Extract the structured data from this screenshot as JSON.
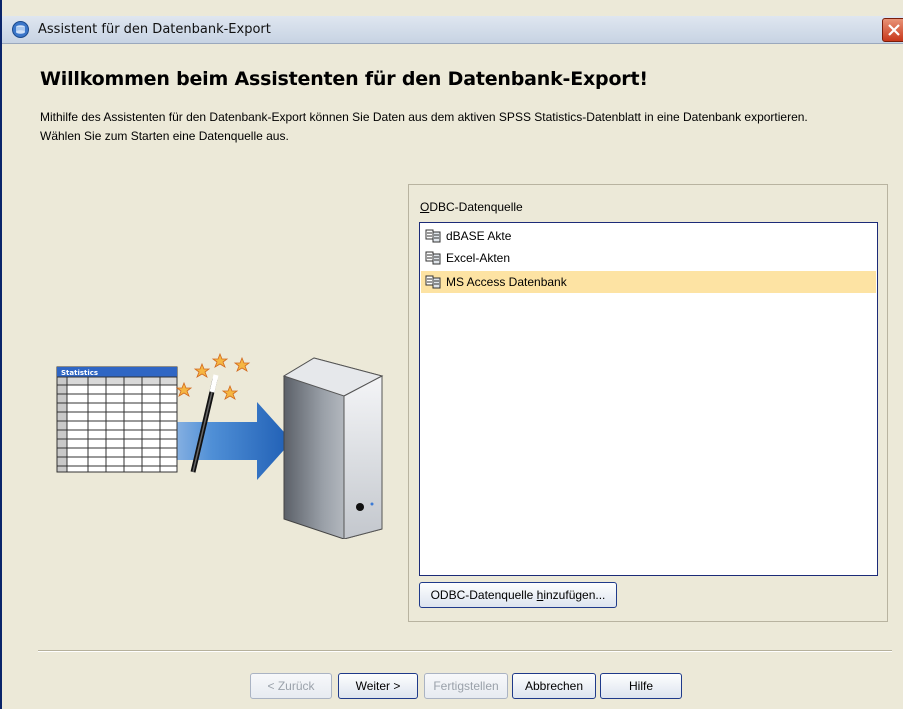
{
  "window": {
    "title": "Assistent für den Datenbank-Export"
  },
  "main": {
    "heading": "Willkommen beim Assistenten für den Datenbank-Export!",
    "description_line1": "Mithilfe des Assistenten für den Datenbank-Export können Sie Daten aus dem aktiven SPSS Statistics-Datenblatt in eine Datenbank exportieren.",
    "description_line2": "Wählen Sie zum Starten eine Datenquelle aus.",
    "illustration_label": "Statistics"
  },
  "odbc": {
    "label_prefix": "O",
    "label_rest": "DBC-Datenquelle",
    "items": [
      {
        "label": "dBASE Akte",
        "icon": "database-icon",
        "selected": false
      },
      {
        "label": "Excel-Akten",
        "icon": "database-icon",
        "selected": false
      },
      {
        "label": "MS Access Datenbank",
        "icon": "database-icon",
        "selected": true
      }
    ],
    "add_button_prefix": "ODBC-Datenquelle ",
    "add_button_mnemonic": "h",
    "add_button_suffix": "inzufügen..."
  },
  "footer": {
    "back": "< Zurück",
    "next": "Weiter >",
    "finish": "Fertigstellen",
    "cancel": "Abbrechen",
    "help": "Hilfe"
  },
  "colors": {
    "selected_row": "#fde3a3",
    "list_border": "#1c2b78",
    "background": "#ece9d8"
  }
}
